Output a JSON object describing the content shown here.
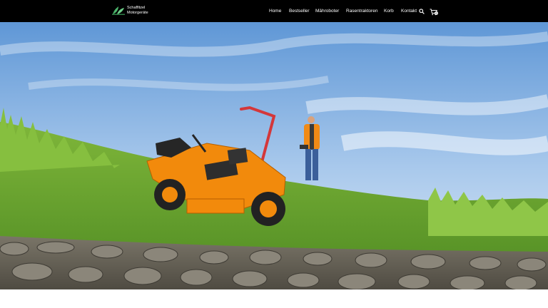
{
  "header": {
    "brand_line1": "Schaffitzel",
    "brand_line2": "Motorgeräte",
    "nav": [
      {
        "label": "Home"
      },
      {
        "label": "Bestseller"
      },
      {
        "label": "Mähroboter"
      },
      {
        "label": "Rasentraktoren"
      },
      {
        "label": "Korb"
      },
      {
        "label": "Kontakt"
      }
    ],
    "cart_count": "0",
    "icons": [
      "leaf-logo-icon",
      "search-icon",
      "cart-icon"
    ]
  },
  "colors": {
    "header_bg": "#000000",
    "mower_orange": "#f28a0c",
    "grass": "#5f9a2a",
    "sky": "#6ea3dc"
  }
}
